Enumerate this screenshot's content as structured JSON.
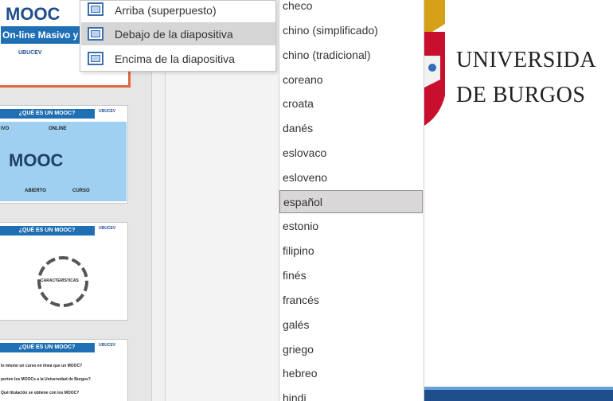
{
  "thumbnails": {
    "slide1": {
      "title": "MOOC",
      "subtitle": "On-line Masivo y A",
      "logo": "UBUCEV"
    },
    "slide_header": "¿QUÉ ES UN MOOC?",
    "mini_logo": "UBUCEV",
    "slide2": {
      "words": [
        "IVO",
        "ONLINE",
        "MOOC",
        "ABIERTO",
        "CURSO"
      ]
    },
    "slide3": {
      "center": "CARACTERÍSTICAS"
    },
    "slide4": {
      "lines": [
        "lo mismo un curso en línea que un MOOC?",
        "porten los MOOCs a la Universidad de Burgos?",
        "Qué titulación se obtiene con los MOOC?"
      ]
    }
  },
  "position_menu": {
    "items": [
      {
        "label": "Arriba (superpuesto)",
        "selected": false
      },
      {
        "label": "Debajo de la diapositiva",
        "selected": true
      },
      {
        "label": "Encima de la diapositiva",
        "selected": false
      }
    ]
  },
  "language_list": {
    "items": [
      "checo",
      "chino (simplificado)",
      "chino (tradicional)",
      "coreano",
      "croata",
      "danés",
      "eslovaco",
      "esloveno",
      "español",
      "estonio",
      "filipino",
      "finés",
      "francés",
      "galés",
      "griego",
      "hebreo",
      "hindi"
    ],
    "selected": "español"
  },
  "preview": {
    "line1": "UNIVERSIDA",
    "line2": "DE BURGOS"
  },
  "colors": {
    "accent": "#1f6fb5",
    "menu_selected": "#d6d6d6",
    "list_selected": "#d9d7d7",
    "slide1_border": "#e0693f",
    "crest_red": "#c8102e"
  }
}
